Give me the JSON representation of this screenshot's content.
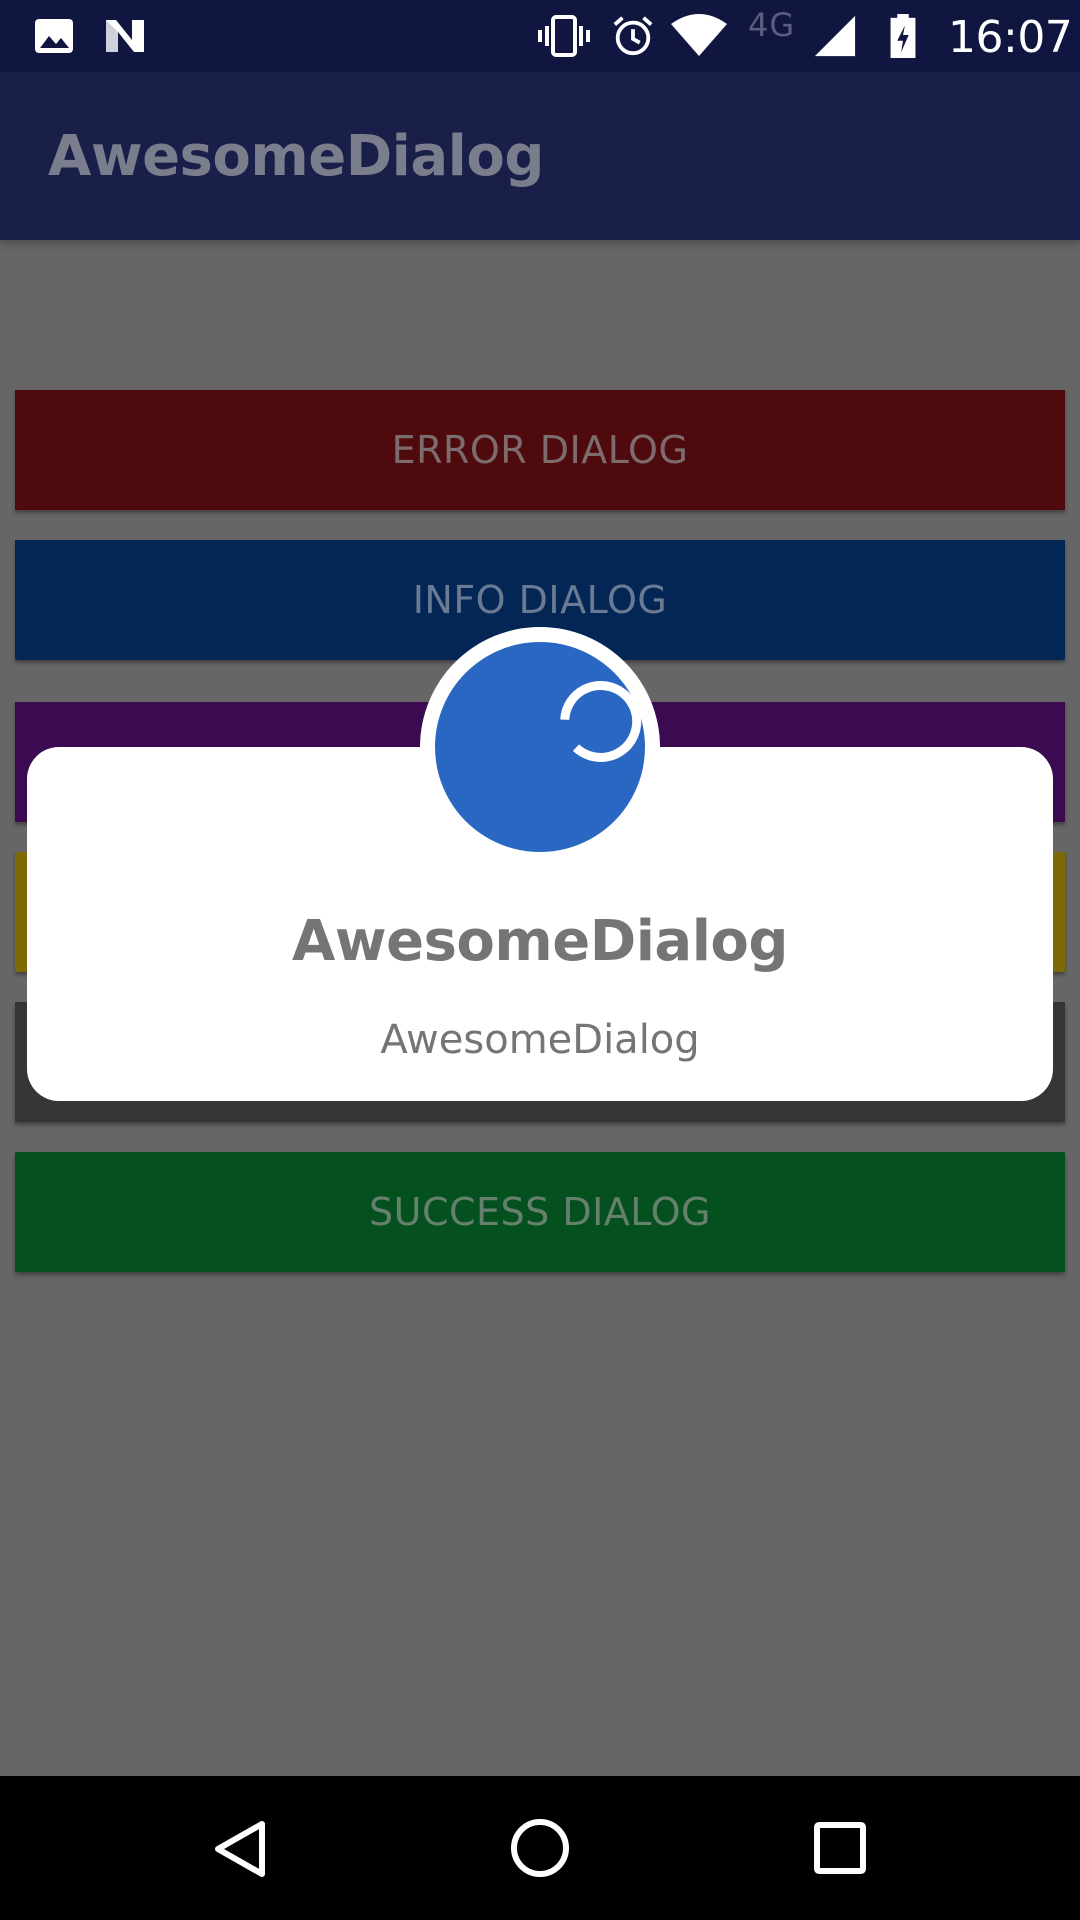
{
  "status_bar": {
    "time": "16:07",
    "network": "4G",
    "icons": [
      "image-icon",
      "n-notification-icon",
      "vibrate-icon",
      "alarm-icon",
      "wifi-icon",
      "cell-signal-icon",
      "battery-charging-icon"
    ]
  },
  "app_bar": {
    "title": "AwesomeDialog"
  },
  "buttons": [
    {
      "label": "ERROR DIALOG",
      "color": "#4e0a0c",
      "text_color": "#7d6c6d"
    },
    {
      "label": "INFO DIALOG",
      "color": "#032655",
      "text_color": "#6a7a92"
    },
    {
      "label": "",
      "color": "#3b0a51"
    },
    {
      "label": "",
      "color": "#7d6806"
    },
    {
      "label": "",
      "color": "#353535"
    },
    {
      "label": "SUCCESS DIALOG",
      "color": "#04501e",
      "text_color": "#66806e"
    }
  ],
  "dialog": {
    "icon": "loading-spinner-icon",
    "accent": "#2967c2",
    "title": "AwesomeDialog",
    "message": "AwesomeDialog"
  },
  "nav_bar": {
    "icons": [
      "back-icon",
      "home-icon",
      "recents-icon"
    ]
  }
}
